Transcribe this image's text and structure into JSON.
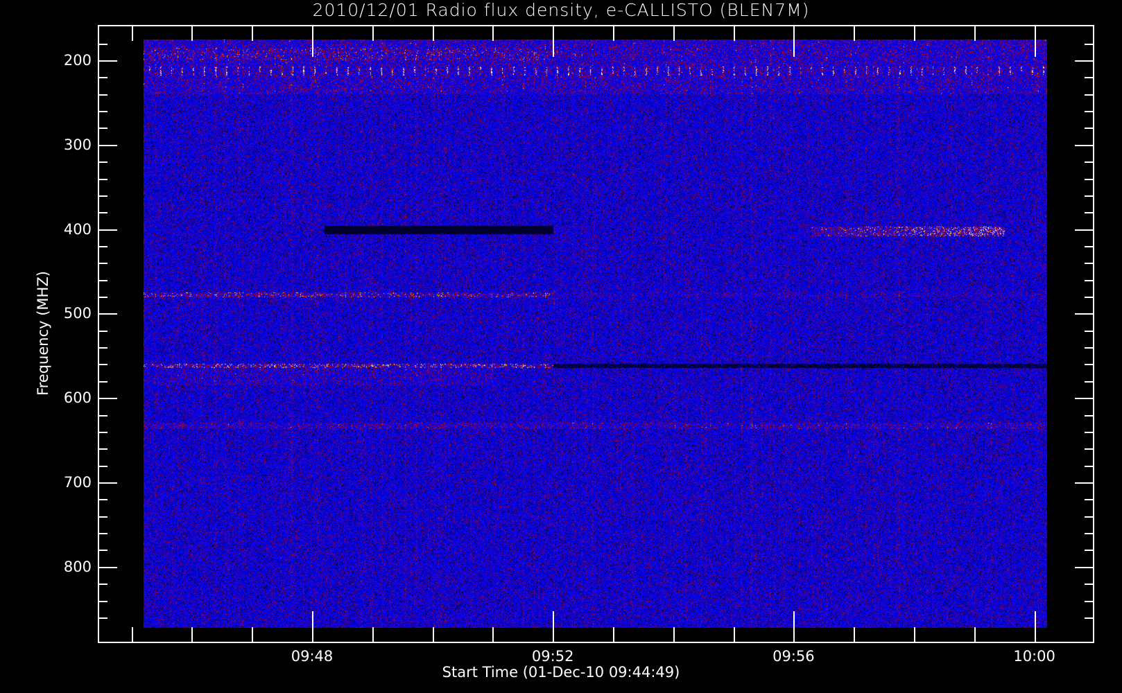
{
  "chart_data": {
    "type": "heatmap",
    "title": "2010/12/01  Radio flux density, e-CALLISTO (BLEN7M)",
    "xlabel": "Start Time (01-Dec-10 09:44:49)",
    "ylabel": "Frequency (MHZ)",
    "x_ticks": [
      "09:48",
      "09:52",
      "09:56",
      "10:00"
    ],
    "y_ticks": [
      "200",
      "300",
      "400",
      "500",
      "600",
      "700",
      "800"
    ],
    "x_range_minutes": [
      0,
      15.4
    ],
    "x_start": "09:44:49",
    "x_end": "10:00:12",
    "ylim_mhz": [
      175,
      873
    ],
    "y_inverted": true,
    "colormap": {
      "low": "#000000",
      "mid": "#1010ff",
      "high": "#c00000",
      "peak": "#ffff40",
      "max": "#ffffff"
    },
    "features": [
      {
        "name": "periodic bursts",
        "freq_mhz": 212,
        "level": "high"
      },
      {
        "name": "broadband red band",
        "freq_mhz": 195,
        "level": "medium",
        "time": "09:44:49-09:52"
      },
      {
        "name": "dark band",
        "freq_mhz": 400,
        "level": "low",
        "time": "09:48:10-09:52"
      },
      {
        "name": "red band",
        "freq_mhz": 403,
        "level": "high",
        "time": "09:56:15-09:59:30"
      },
      {
        "name": "interference line",
        "freq_mhz": 478,
        "level": "high"
      },
      {
        "name": "interference line",
        "freq_mhz": 562,
        "level": "peak",
        "time": "09:44:49-09:52"
      },
      {
        "name": "interference line",
        "freq_mhz": 633,
        "level": "medium"
      }
    ]
  }
}
